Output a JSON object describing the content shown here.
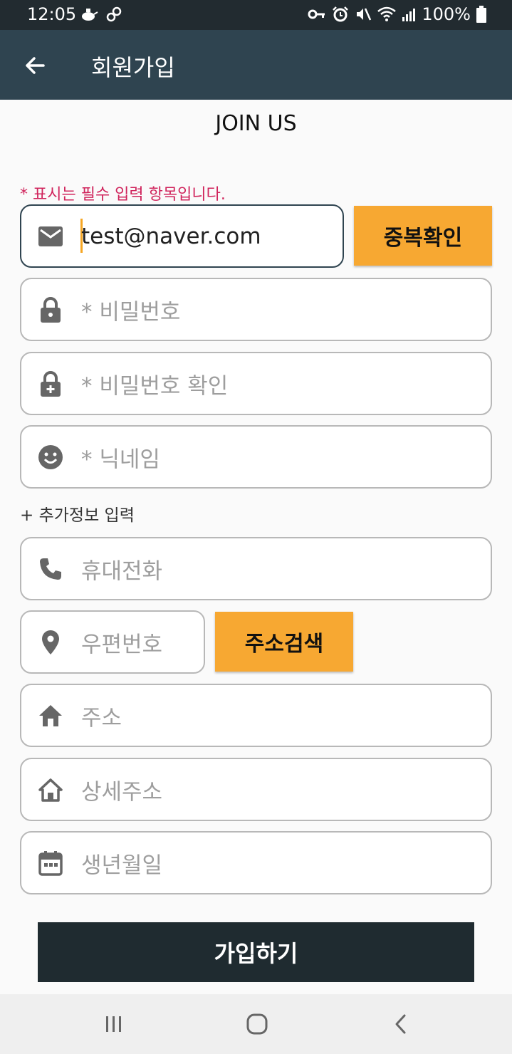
{
  "status_bar": {
    "time": "12:05",
    "battery": "100%",
    "left_icons": [
      "teapot-icon",
      "link-icon"
    ],
    "right_icons": [
      "key-icon",
      "alarm-icon",
      "mute-icon",
      "wifi-icon",
      "signal-icon",
      "battery-icon"
    ]
  },
  "app_bar": {
    "title": "회원가입",
    "back_icon": "arrow-back-icon"
  },
  "form": {
    "heading": "JOIN US",
    "required_note": "* 표시는 필수 입력 항목입니다.",
    "email_value": "test@naver.com",
    "dup_check_button": "중복확인",
    "password_placeholder": "* 비밀번호",
    "password_confirm_placeholder": "* 비밀번호 확인",
    "nickname_placeholder": "* 닉네임",
    "extra_info_label": "+ 추가정보 입력",
    "phone_placeholder": "휴대전화",
    "zipcode_placeholder": "우편번호",
    "address_search_button": "주소검색",
    "address_placeholder": "주소",
    "address_detail_placeholder": "상세주소",
    "birthdate_placeholder": "생년월일",
    "submit_button": "가입하기"
  },
  "colors": {
    "status_bar": "#222b30",
    "app_bar": "#2f4450",
    "accent_orange": "#f7a832",
    "required_text": "#d0245c",
    "submit_bg": "#1f2b30"
  },
  "nav_bar": {
    "icons": [
      "recent-apps-icon",
      "home-icon",
      "back-icon"
    ]
  }
}
